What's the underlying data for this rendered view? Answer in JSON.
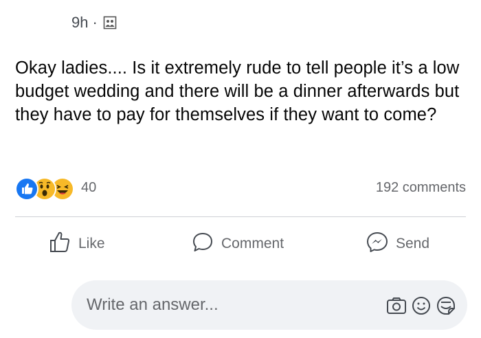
{
  "post": {
    "time": "9h",
    "separator": "·",
    "privacy_icon": "group-icon",
    "text": "Okay ladies.... Is it extremely rude to tell people it’s a low budget wedding and there will be a dinner afterwards but they have to pay for themselves if they want to come?"
  },
  "stats": {
    "reactions": [
      "like-reaction-icon",
      "wow-reaction-icon",
      "haha-reaction-icon"
    ],
    "reaction_count": "40",
    "comments": "192 comments"
  },
  "actions": {
    "like_label": "Like",
    "comment_label": "Comment",
    "send_label": "Send"
  },
  "composer": {
    "placeholder": "Write an answer...",
    "icons": [
      "camera-icon",
      "emoji-icon",
      "sticker-icon"
    ]
  },
  "colors": {
    "like_blue": "#1877f2",
    "reaction_yellow": "#f7b928",
    "secondary_text": "#65676b",
    "composer_bg": "#f0f2f5"
  }
}
